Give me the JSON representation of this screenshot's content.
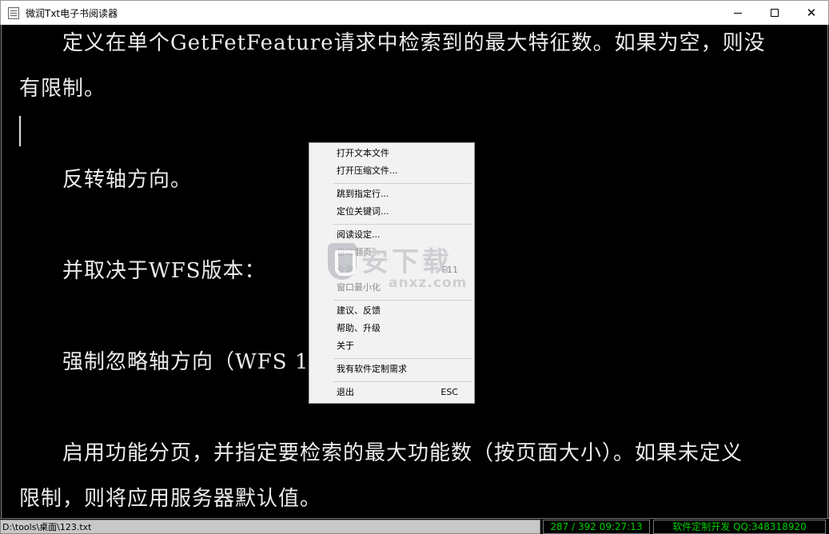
{
  "window": {
    "title": "微润Txt电子书阅读器",
    "icon": "notepad-icon"
  },
  "reader": {
    "lines": [
      "　　定义在单个GetFetFeature请求中检索到的最大特征数。如果为空，则没",
      "有限制。",
      "　　反转轴方向。",
      "　　并取决于WFS版本：",
      "　　强制忽略轴方向（WFS 1",
      "　　启用功能分页，并指定要检索的最大功能数（按页面大小）。如果未定义",
      "限制，则将应用服务器默认值。"
    ]
  },
  "context_menu": {
    "items": [
      {
        "label": "打开文本文件",
        "shortcut": "",
        "enabled": true
      },
      {
        "label": "打开压缩文件...",
        "shortcut": "",
        "enabled": true
      },
      {
        "label": "跳到指定行...",
        "shortcut": "",
        "enabled": true
      },
      {
        "label": "定位关键词...",
        "shortcut": "",
        "enabled": true
      },
      {
        "label": "阅读设定...",
        "shortcut": "",
        "enabled": true
      },
      {
        "label": "自动翻页...",
        "shortcut": "",
        "enabled": false
      },
      {
        "label": "全屏",
        "shortcut": "F11",
        "enabled": false
      },
      {
        "label": "窗口最小化",
        "shortcut": "",
        "enabled": false
      },
      {
        "label": "建议、反馈",
        "shortcut": "",
        "enabled": true
      },
      {
        "label": "帮助、升级",
        "shortcut": "",
        "enabled": true
      },
      {
        "label": "关于",
        "shortcut": "",
        "enabled": true
      },
      {
        "label": "我有软件定制需求",
        "shortcut": "",
        "enabled": true
      },
      {
        "label": "退出",
        "shortcut": "ESC",
        "enabled": true
      }
    ]
  },
  "watermark": {
    "big": "安下载",
    "small": "anxz.com"
  },
  "status_bar": {
    "path": "D:\\tools\\桌面\\123.txt",
    "page_time": "287 / 392  09:27:13",
    "developer": "软件定制开发 QQ:348318920"
  }
}
